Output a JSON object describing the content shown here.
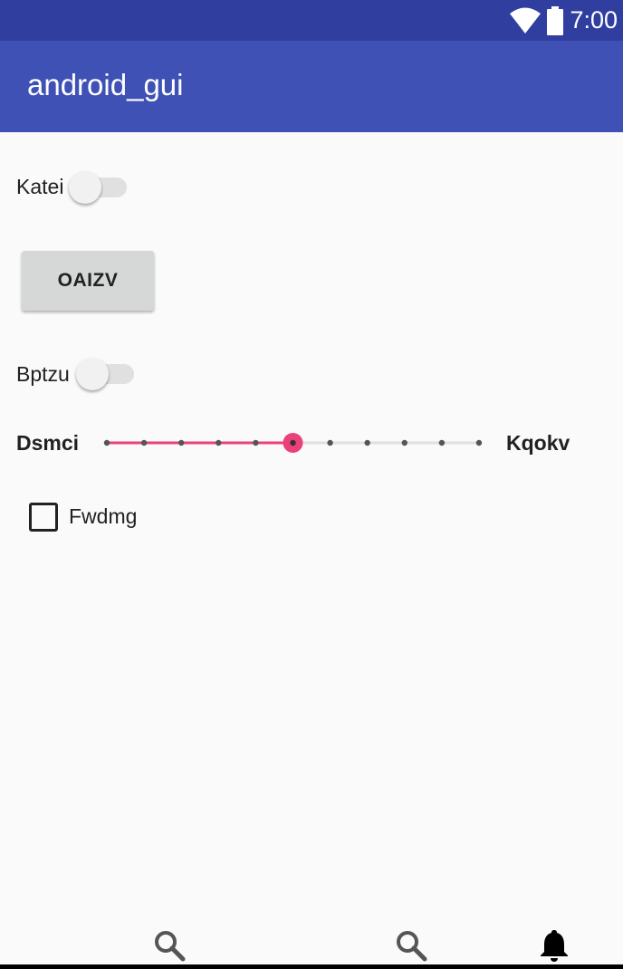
{
  "status_bar": {
    "time": "7:00",
    "icons": [
      "wifi-icon",
      "battery-icon"
    ],
    "color": "#303f9f"
  },
  "app_bar": {
    "title": "android_gui",
    "color": "#3f51b5"
  },
  "form": {
    "switch1": {
      "label": "Katei",
      "checked": false
    },
    "button": {
      "label": "OAIZV"
    },
    "switch2": {
      "label": "Bptzu",
      "checked": false
    },
    "slider": {
      "min_label": "Dsmci",
      "max_label": "Kqokv",
      "steps": 10,
      "value": 5,
      "accent_color": "#ec407a"
    },
    "checkbox": {
      "label": "Fwdmg",
      "checked": false
    }
  },
  "bottom_nav": {
    "icons": [
      "search-icon",
      "search-icon",
      "bell-icon"
    ]
  }
}
